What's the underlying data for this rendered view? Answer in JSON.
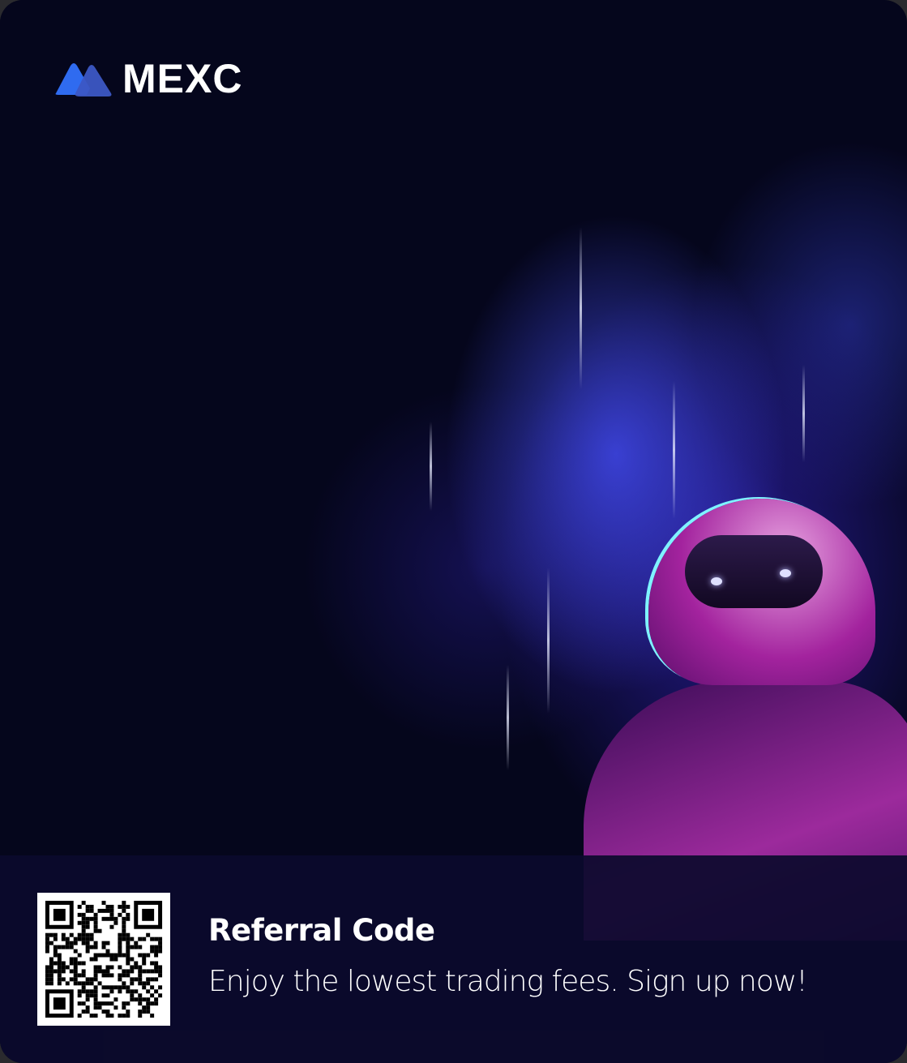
{
  "brand": {
    "name": "MEXC",
    "logo_colors": [
      "#2f6bf0",
      "#3c4fb8"
    ]
  },
  "referral": {
    "title": "Referral Code",
    "subtitle": "Enjoy the lowest trading fees. Sign up now!"
  },
  "colors": {
    "background": "#05061c",
    "panel": "#0b0a2c",
    "text": "#ffffff"
  }
}
